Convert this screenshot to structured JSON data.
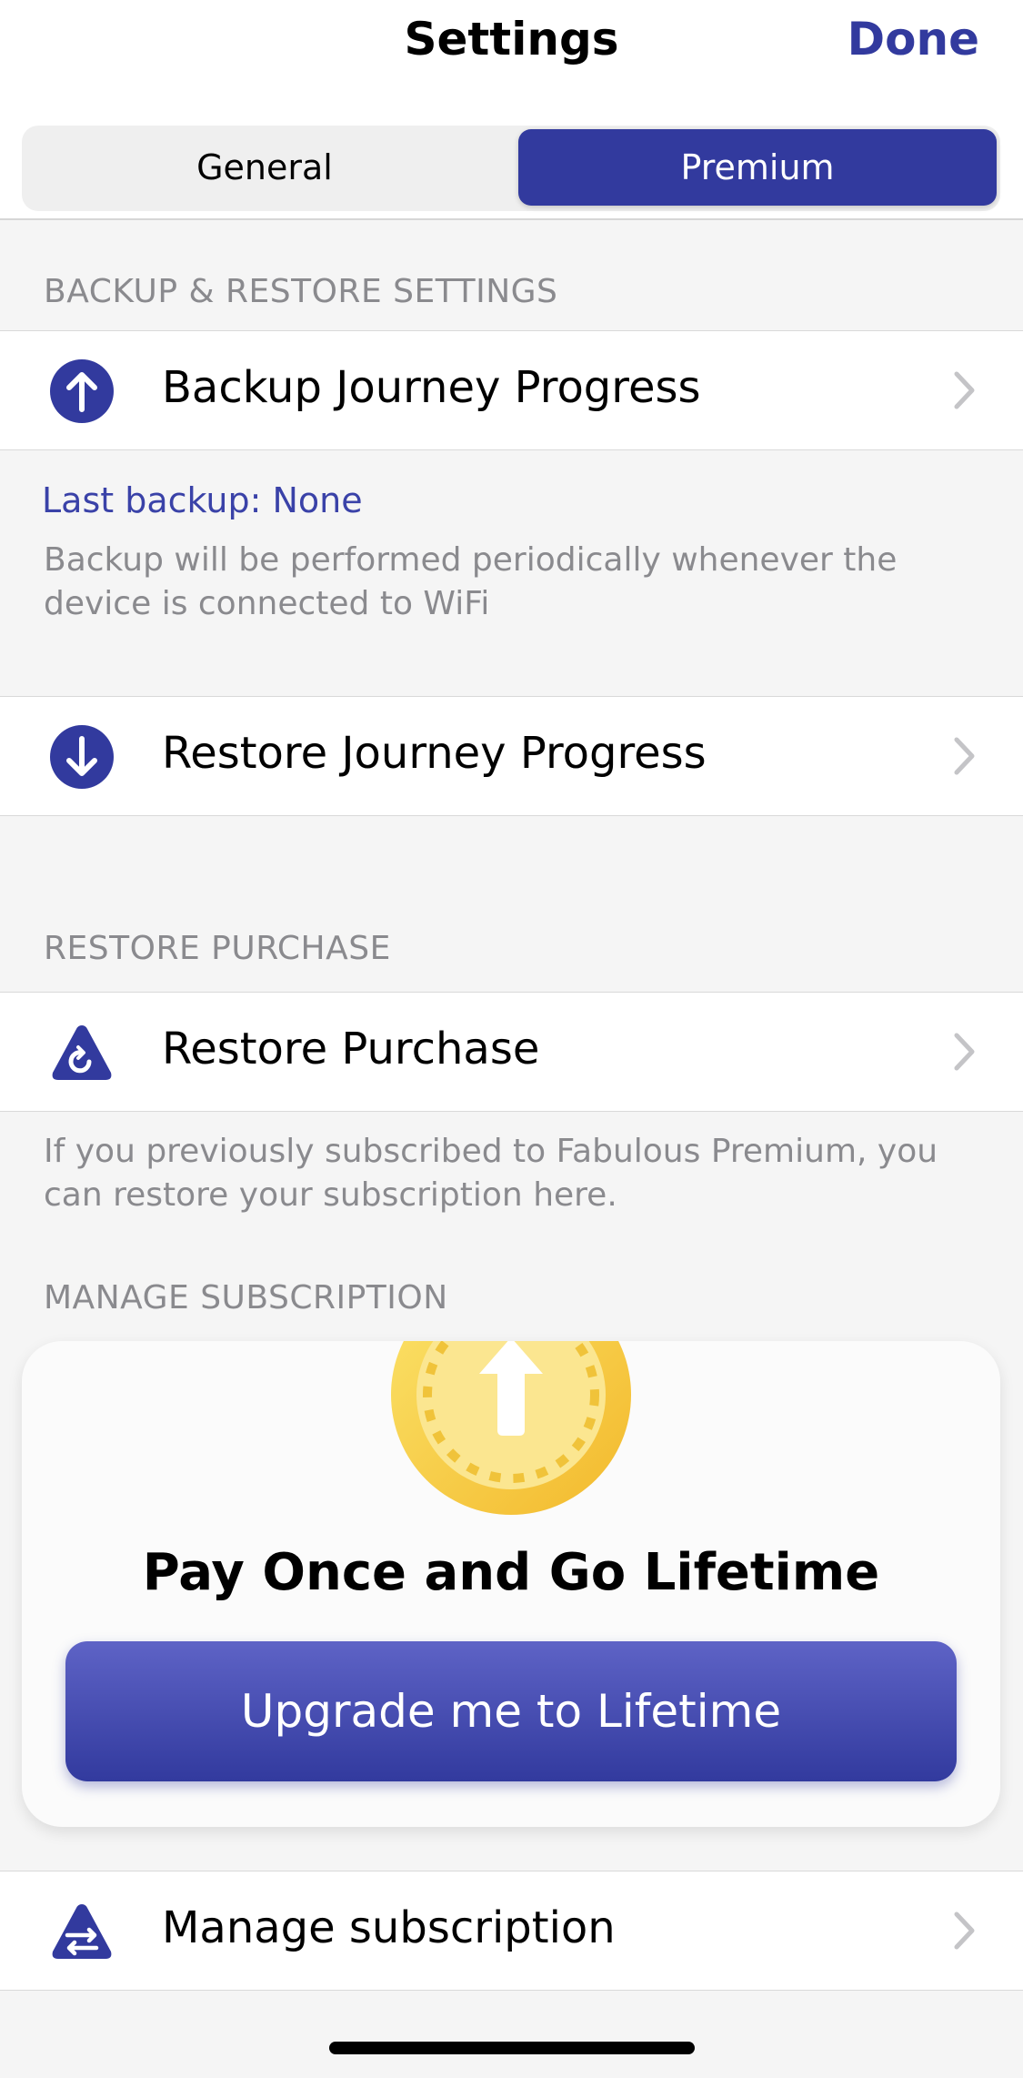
{
  "nav": {
    "title": "Settings",
    "done_label": "Done"
  },
  "tabs": [
    {
      "label": "General",
      "selected": false
    },
    {
      "label": "Premium",
      "selected": true
    }
  ],
  "sections": {
    "backup": {
      "header": "BACKUP & RESTORE SETTINGS",
      "backup_row": {
        "label": "Backup Journey Progress",
        "icon": "arrow-up-circle-icon"
      },
      "last_backup": "Last backup: None",
      "note": "Backup will be performed periodically whenever the device is connected to WiFi",
      "restore_row": {
        "label": "Restore Journey Progress",
        "icon": "arrow-down-circle-icon"
      }
    },
    "restore_purchase": {
      "header": "RESTORE PURCHASE",
      "row": {
        "label": "Restore Purchase",
        "icon": "restore-triangle-icon"
      },
      "note": "If you previously subscribed to Fabulous Premium, you can restore your subscription here."
    },
    "manage_subscription": {
      "header": "MANAGE SUBSCRIPTION",
      "card": {
        "title": "Pay Once and Go Lifetime",
        "button_label": "Upgrade me to Lifetime",
        "icon": "gold-coin-upgrade-icon"
      },
      "row": {
        "label": "Manage subscription",
        "icon": "manage-subscription-icon"
      }
    }
  },
  "colors": {
    "accent": "#323a9e",
    "link": "#3a42a8",
    "secondary_text": "#8a8a8e",
    "background": "#f5f5f5",
    "coin_gold": "#f7c83a"
  }
}
